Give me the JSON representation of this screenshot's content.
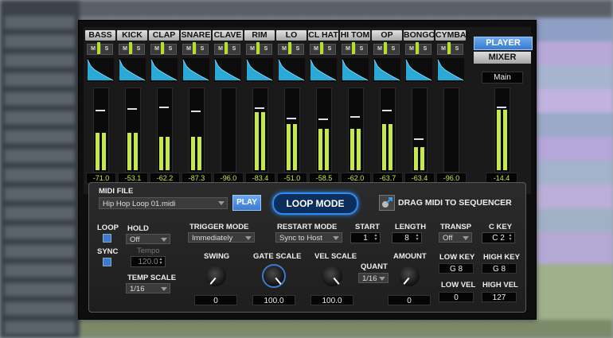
{
  "channels": [
    {
      "name": "BASS",
      "value": "-71.0",
      "lvl": 0.45,
      "pk": 0.72
    },
    {
      "name": "KICK",
      "value": "-53.1",
      "lvl": 0.45,
      "pk": 0.74
    },
    {
      "name": "CLAP",
      "value": "-62.2",
      "lvl": 0.4,
      "pk": 0.76
    },
    {
      "name": "SNARE",
      "value": "-87.3",
      "lvl": 0.4,
      "pk": 0.71
    },
    {
      "name": "CLAVE",
      "value": "-96.0",
      "lvl": 0.0,
      "pk": 0.0
    },
    {
      "name": "RIM",
      "value": "-83.4",
      "lvl": 0.7,
      "pk": 0.75
    },
    {
      "name": "LO TOM",
      "value": "-51.0",
      "lvl": 0.55,
      "pk": 0.63
    },
    {
      "name": "CL HAT",
      "value": "-58.5",
      "lvl": 0.5,
      "pk": 0.62
    },
    {
      "name": "HI TOM",
      "value": "-62.0",
      "lvl": 0.5,
      "pk": 0.65
    },
    {
      "name": "OP HAT",
      "value": "-63.7",
      "lvl": 0.55,
      "pk": 0.72
    },
    {
      "name": "BONGO",
      "value": "-63.4",
      "lvl": 0.28,
      "pk": 0.38
    },
    {
      "name": "CYMBAL",
      "value": "-96.0",
      "lvl": 0.0,
      "pk": 0.0
    }
  ],
  "mute_label": "M",
  "solo_label": "S",
  "nav": {
    "player": "PLAYER",
    "mixer": "MIXER",
    "main": "Main"
  },
  "main_value": "-14.4",
  "panel": {
    "midi_file_label": "MIDI FILE",
    "midi_file": "Hip Hop Loop 01.midi",
    "play": "PLAY",
    "loop_mode": "LOOP MODE",
    "drag": "DRAG MIDI TO SEQUENCER",
    "loop": "LOOP",
    "sync": "SYNC",
    "hold": "HOLD",
    "hold_value": "Off",
    "tempo": "Tempo",
    "tempo_value": "120.0",
    "temp_scale": "TEMP SCALE",
    "temp_scale_value": "1/16",
    "trigger_mode": "TRIGGER MODE",
    "trigger_value": "Immediately",
    "restart_mode": "RESTART MODE",
    "restart_value": "Sync to Host",
    "start": "START",
    "start_value": "1",
    "length": "LENGTH",
    "length_value": "8",
    "transp": "TRANSP",
    "transp_value": "Off",
    "c_key": "C KEY",
    "c_key_value": "C 2",
    "swing": "SWING",
    "swing_value": "0",
    "gate_scale": "GATE SCALE",
    "gate_value": "100.0",
    "vel_scale": "VEL SCALE",
    "vel_value": "100.0",
    "quant": "QUANT",
    "quant_value": "1/16",
    "amount": "AMOUNT",
    "amount_value": "0",
    "low_key": "LOW KEY",
    "low_key_value": "G 8",
    "high_key": "HIGH KEY",
    "high_key_value": "G 8",
    "low_vel": "LOW VEL",
    "low_vel_value": "0",
    "high_vel": "HIGH VEL",
    "high_vel_value": "127"
  },
  "colors": {
    "accent": "#3a7ad0",
    "meter": "#c7e84a",
    "envelope": "#2aa8d8"
  }
}
